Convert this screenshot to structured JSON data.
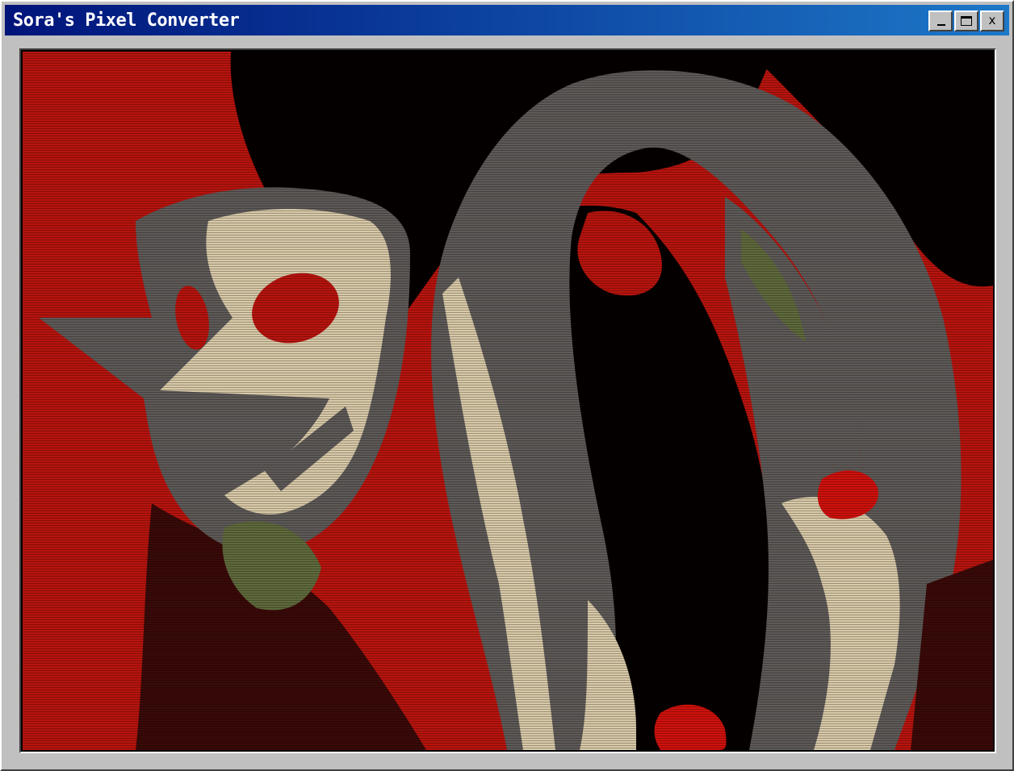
{
  "window": {
    "title": "Sora's Pixel Converter",
    "buttons": {
      "minimize": "_",
      "maximize": "□",
      "close": "x"
    }
  },
  "image": {
    "palette": {
      "red": "#b8140e",
      "black": "#050000",
      "dark_maroon": "#3a0a08",
      "gray": "#5e5a58",
      "cream": "#d8c9a8",
      "olive": "#5f6a3c",
      "bright_red": "#d0110c"
    }
  }
}
